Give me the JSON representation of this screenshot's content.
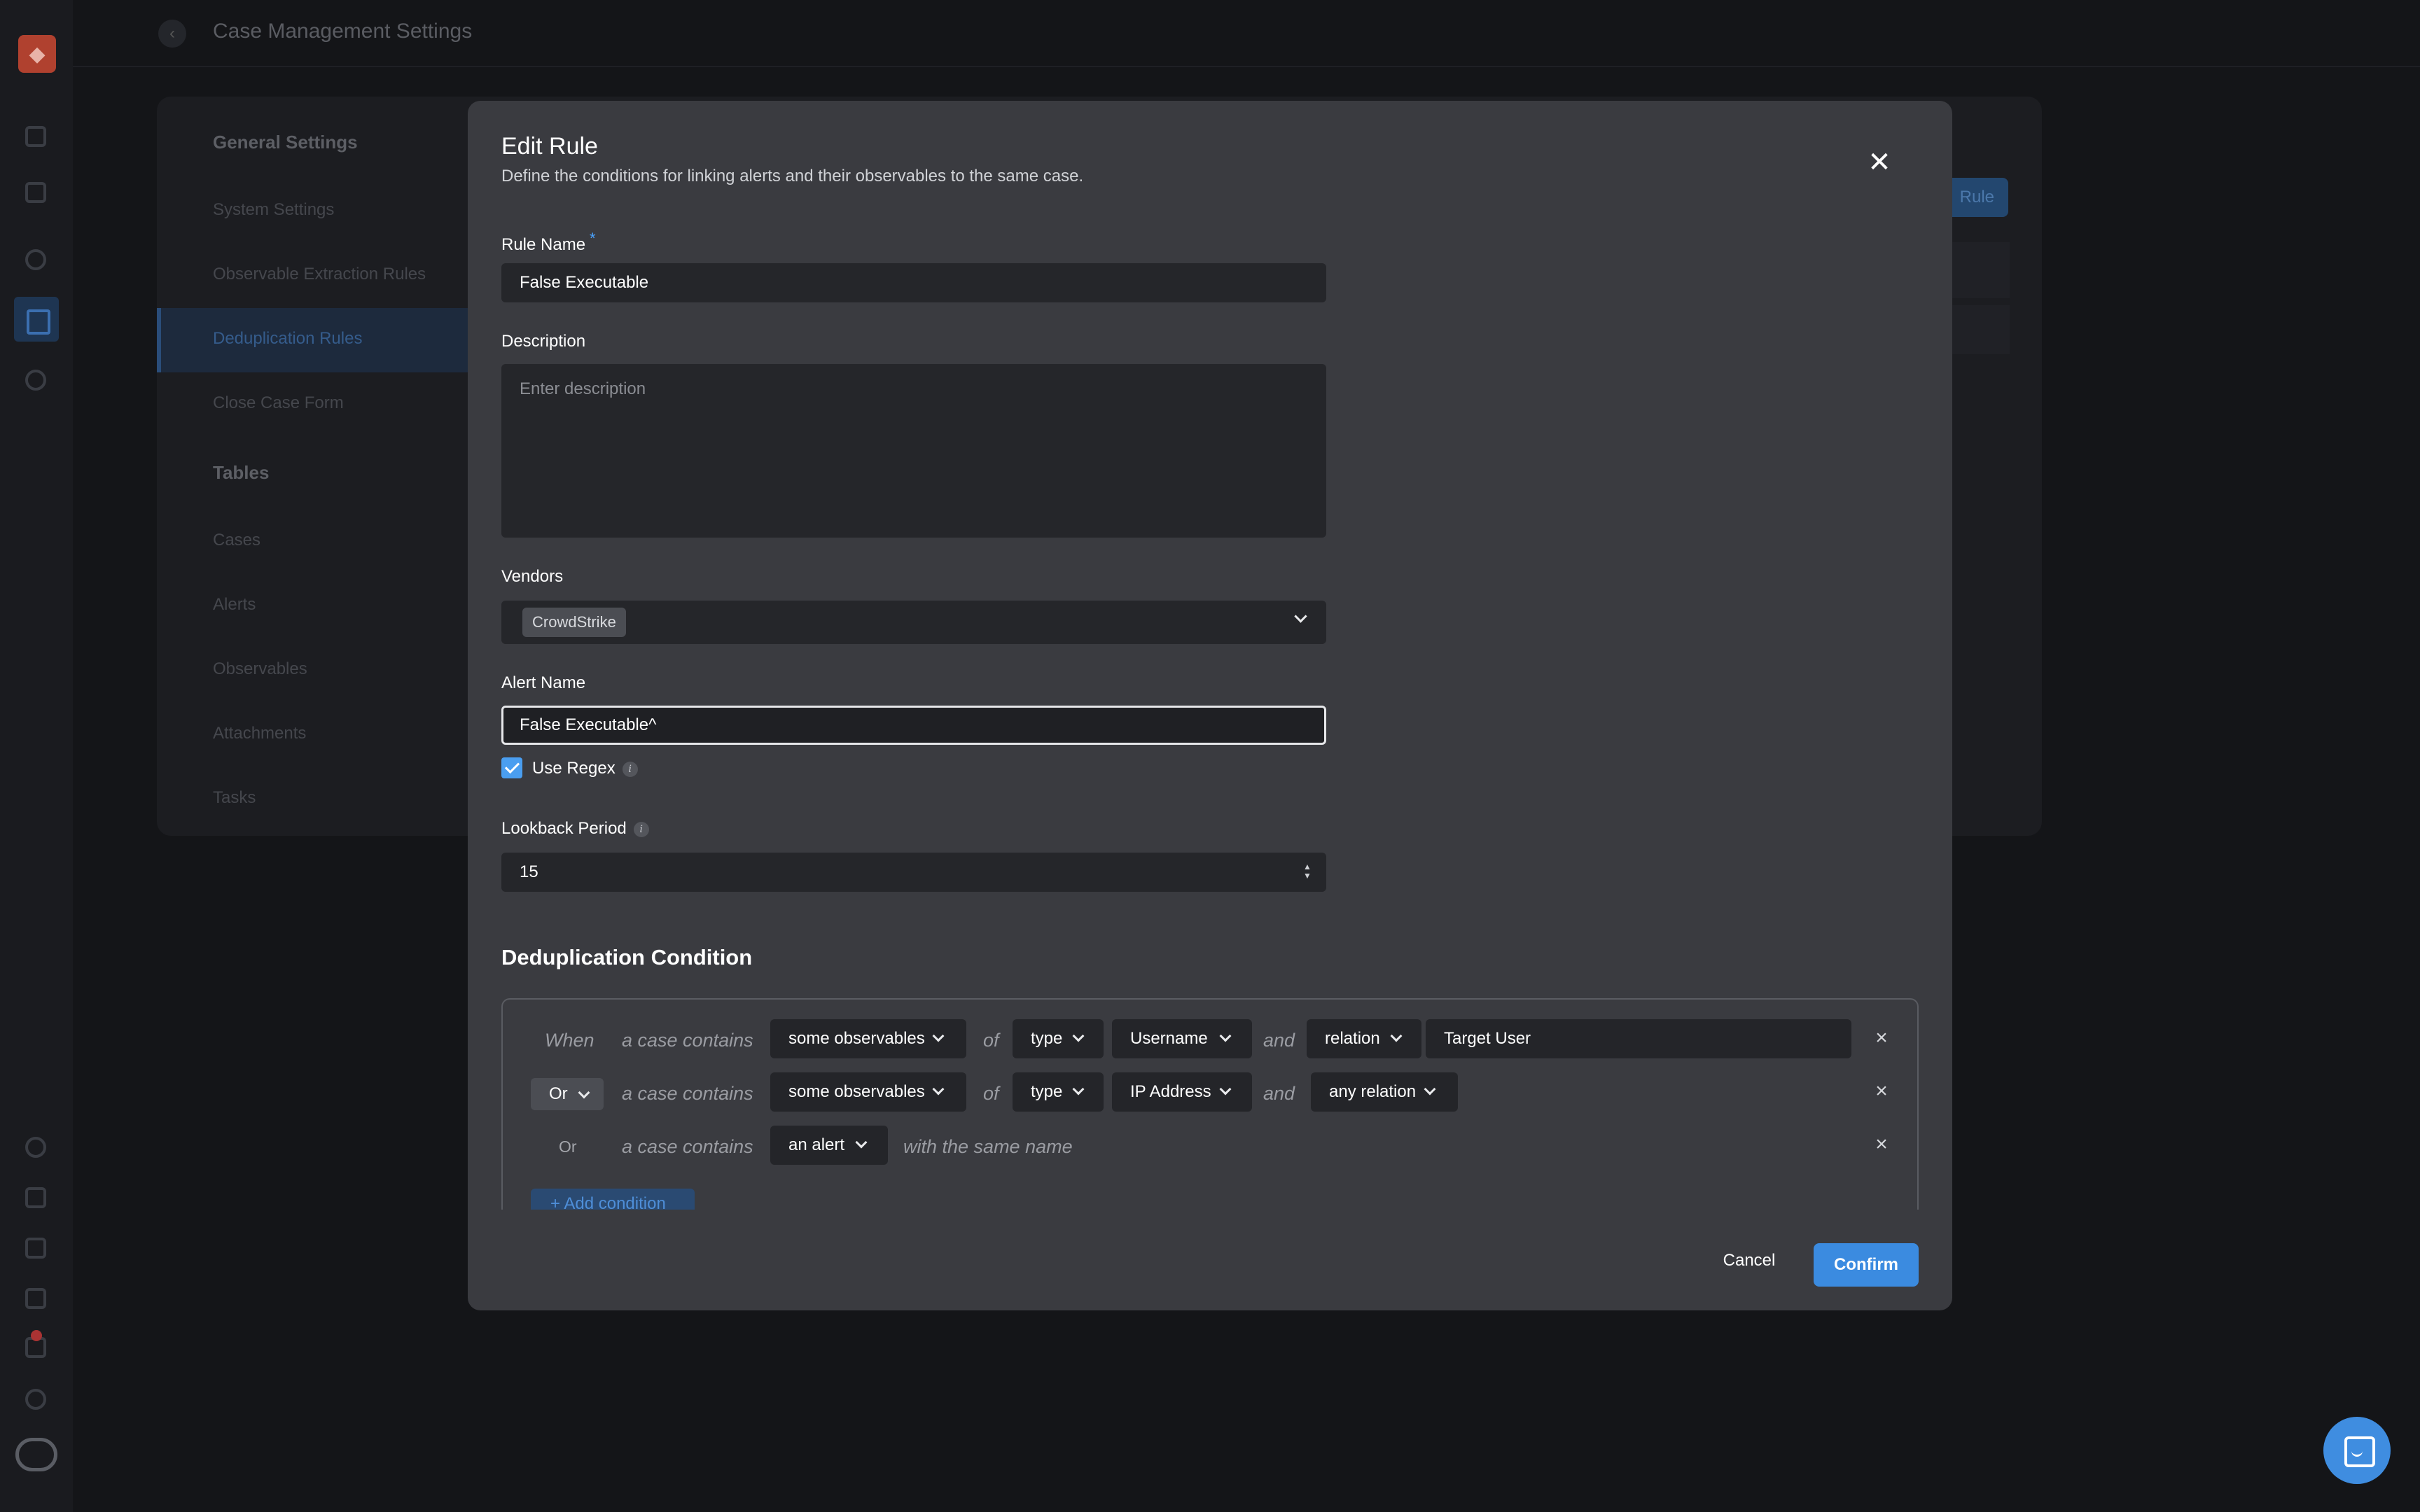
{
  "app": {
    "page_title": "Case Management Settings",
    "settings_nav": {
      "general_heading": "General Settings",
      "items": [
        "System Settings",
        "Observable Extraction Rules",
        "Deduplication Rules",
        "Close Case Form"
      ],
      "selected": "Deduplication Rules",
      "tables_heading": "Tables",
      "table_items": [
        "Cases",
        "Alerts",
        "Observables",
        "Attachments",
        "Tasks"
      ]
    },
    "add_rule_label": "Rule"
  },
  "modal": {
    "title": "Edit Rule",
    "subtitle": "Define the conditions for linking alerts and their observables to the same case.",
    "rule_name": {
      "label": "Rule Name",
      "required_mark": "*",
      "value": "False Executable"
    },
    "description": {
      "label": "Description",
      "placeholder": "Enter description"
    },
    "vendors": {
      "label": "Vendors",
      "selected": [
        "CrowdStrike"
      ]
    },
    "alert_name": {
      "label": "Alert Name",
      "value": "False Executable^"
    },
    "use_regex": {
      "label": "Use Regex",
      "checked": true
    },
    "lookback": {
      "label": "Lookback Period",
      "value": "15"
    },
    "dedup": {
      "title": "Deduplication Condition",
      "rows": [
        {
          "lead": "When",
          "contains": "a case contains",
          "target": "some observables",
          "of": "of",
          "attr": "type",
          "type_value": "Username",
          "and": "and",
          "relation": "relation",
          "relation_value": "Target User"
        },
        {
          "lead": "Or",
          "contains": "a case contains",
          "target": "some observables",
          "of": "of",
          "attr": "type",
          "type_value": "IP Address",
          "and": "and",
          "relation": "any relation"
        },
        {
          "lead": "Or",
          "contains": "a case contains",
          "target": "an alert",
          "suffix": "with the same name"
        }
      ],
      "add_label": "+ Add condition"
    },
    "cancel_label": "Cancel",
    "confirm_label": "Confirm"
  },
  "colors": {
    "accent": "#3b8be0",
    "modal_bg": "#3a3b40",
    "field_bg": "#25262a",
    "page_bg": "#141518"
  }
}
